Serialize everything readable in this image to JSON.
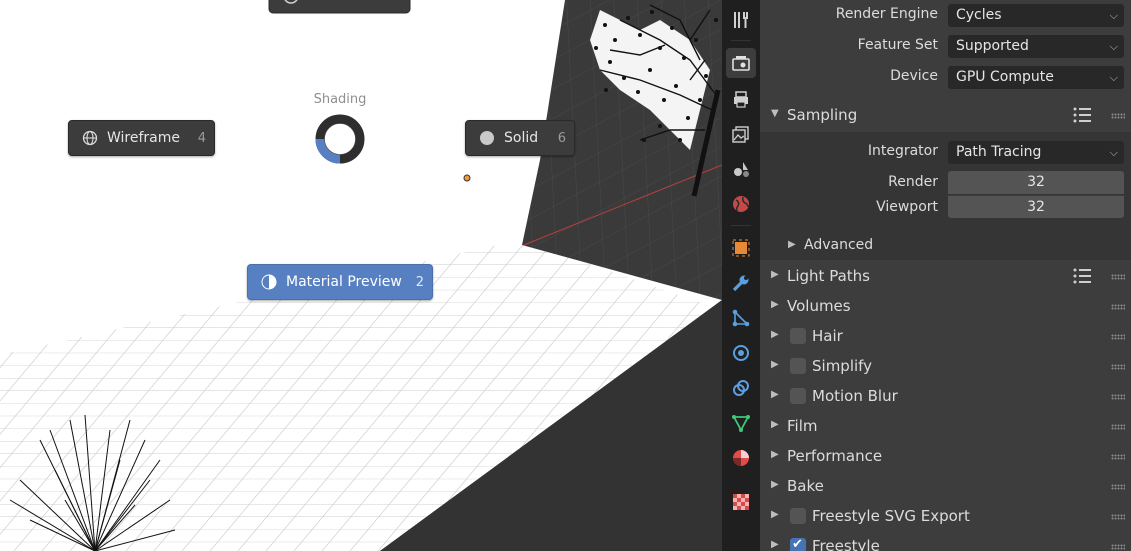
{
  "viewport": {
    "pie_menu": {
      "title": "Shading",
      "wireframe": {
        "label": "Wireframe",
        "key": "4",
        "icon": "wireframe-globe-icon"
      },
      "solid": {
        "label": "Solid",
        "key": "6",
        "icon": "solid-sphere-icon"
      },
      "material_preview": {
        "label": "Material Preview",
        "key": "2",
        "icon": "material-preview-sphere-icon",
        "active": true
      },
      "accent": "#5680c2"
    }
  },
  "tabs": [
    {
      "name": "tool-tab",
      "icon": "tool-icon"
    },
    {
      "name": "render-tab",
      "icon": "render-camera-icon",
      "active": true
    },
    {
      "name": "output-tab",
      "icon": "printer-icon"
    },
    {
      "name": "view-layer-tab",
      "icon": "image-stack-icon"
    },
    {
      "name": "scene-tab",
      "icon": "scene-icon"
    },
    {
      "name": "world-tab",
      "icon": "world-icon"
    },
    {
      "name": "object-tab",
      "icon": "object-square-icon"
    },
    {
      "name": "modifier-tab",
      "icon": "wrench-icon"
    },
    {
      "name": "particles-tab",
      "icon": "particles-icon"
    },
    {
      "name": "physics-tab",
      "icon": "physics-icon"
    },
    {
      "name": "constraints-tab",
      "icon": "constraint-icon"
    },
    {
      "name": "data-tab",
      "icon": "mesh-data-icon"
    },
    {
      "name": "material-tab",
      "icon": "material-icon"
    },
    {
      "name": "texture-tab",
      "icon": "checker-texture-icon"
    }
  ],
  "properties": {
    "render_engine": {
      "label": "Render Engine",
      "value": "Cycles"
    },
    "feature_set": {
      "label": "Feature Set",
      "value": "Supported"
    },
    "device": {
      "label": "Device",
      "value": "GPU Compute"
    },
    "sampling": {
      "title": "Sampling",
      "integrator": {
        "label": "Integrator",
        "value": "Path Tracing"
      },
      "render": {
        "label": "Render",
        "value": "32"
      },
      "viewport": {
        "label": "Viewport",
        "value": "32"
      },
      "advanced": "Advanced"
    },
    "panels": [
      {
        "title": "Light Paths",
        "checkbox": null
      },
      {
        "title": "Volumes",
        "checkbox": null
      },
      {
        "title": "Hair",
        "checkbox": false
      },
      {
        "title": "Simplify",
        "checkbox": false
      },
      {
        "title": "Motion Blur",
        "checkbox": false
      },
      {
        "title": "Film",
        "checkbox": null
      },
      {
        "title": "Performance",
        "checkbox": null
      },
      {
        "title": "Bake",
        "checkbox": null
      },
      {
        "title": "Freestyle SVG Export",
        "checkbox": false
      },
      {
        "title": "Freestyle",
        "checkbox": true
      }
    ]
  }
}
